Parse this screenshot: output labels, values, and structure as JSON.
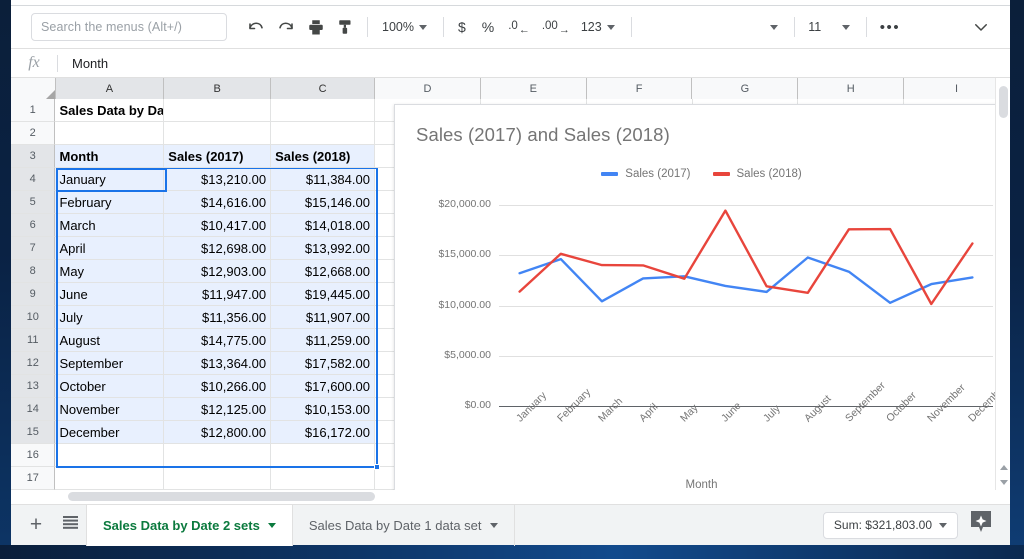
{
  "toolbar": {
    "search_placeholder": "Search the menus (Alt+/)",
    "undo": "undo-icon",
    "redo": "redo-icon",
    "print": "print-icon",
    "paint_format": "paint-format-icon",
    "zoom": "100%",
    "currency": "$",
    "percent": "%",
    "decrease_decimal": ".0",
    "increase_decimal": ".00",
    "number_format": "123",
    "font_family": "",
    "font_size": "11",
    "more": "•••"
  },
  "formula_bar": {
    "fx_label": "fx",
    "value": "Month"
  },
  "grid": {
    "columns": [
      "A",
      "B",
      "C",
      "D",
      "E",
      "F",
      "G",
      "H",
      "I"
    ],
    "selected_columns": [
      "A",
      "B",
      "C"
    ],
    "row_numbers": [
      "1",
      "2",
      "3",
      "4",
      "5",
      "6",
      "7",
      "8",
      "9",
      "10",
      "11",
      "12",
      "13",
      "14",
      "15",
      "16",
      "17"
    ],
    "title_cell": "Sales Data by Date",
    "headers": [
      "Month",
      "Sales (2017)",
      "Sales (2018)"
    ],
    "rows": [
      [
        "January",
        "$13,210.00",
        "$11,384.00"
      ],
      [
        "February",
        "$14,616.00",
        "$15,146.00"
      ],
      [
        "March",
        "$10,417.00",
        "$14,018.00"
      ],
      [
        "April",
        "$12,698.00",
        "$13,992.00"
      ],
      [
        "May",
        "$12,903.00",
        "$12,668.00"
      ],
      [
        "June",
        "$11,947.00",
        "$19,445.00"
      ],
      [
        "July",
        "$11,356.00",
        "$11,907.00"
      ],
      [
        "August",
        "$14,775.00",
        "$11,259.00"
      ],
      [
        "September",
        "$13,364.00",
        "$17,582.00"
      ],
      [
        "October",
        "$10,266.00",
        "$17,600.00"
      ],
      [
        "November",
        "$12,125.00",
        "$10,153.00"
      ],
      [
        "December",
        "$12,800.00",
        "$16,172.00"
      ]
    ]
  },
  "chart_data": {
    "type": "line",
    "title": "Sales (2017) and Sales (2018)",
    "xlabel": "Month",
    "ylabel": "",
    "categories": [
      "January",
      "February",
      "March",
      "April",
      "May",
      "June",
      "July",
      "August",
      "September",
      "October",
      "November",
      "December"
    ],
    "series": [
      {
        "name": "Sales (2017)",
        "color": "#4285f4",
        "values": [
          13210,
          14616,
          10417,
          12698,
          12903,
          11947,
          11356,
          14775,
          13364,
          10266,
          12125,
          12800
        ]
      },
      {
        "name": "Sales (2018)",
        "color": "#e8453c",
        "values": [
          11384,
          15146,
          14018,
          13992,
          12668,
          19445,
          11907,
          11259,
          17582,
          17600,
          10153,
          16172
        ]
      }
    ],
    "ylim": [
      0,
      20000
    ],
    "yticks": [
      0,
      5000,
      10000,
      15000,
      20000
    ],
    "ytick_labels": [
      "$0.00",
      "$5,000.00",
      "$10,000.00",
      "$15,000.00",
      "$20,000.00"
    ],
    "grid": true,
    "legend_position": "top"
  },
  "tabs": {
    "add_label": "+",
    "all_sheets_label": "all-sheets-icon",
    "items": [
      {
        "label": "Sales Data by Date 2 sets",
        "active": true
      },
      {
        "label": "Sales Data by Date 1 data set",
        "active": false
      }
    ]
  },
  "status": {
    "sum": "Sum: $321,803.00",
    "explore": "explore-icon"
  },
  "colors": {
    "series_2017": "#4285f4",
    "series_2018": "#e8453c",
    "active_tab": "#0b7a3e",
    "selection": "#1a73e8",
    "selection_fill": "#e8f0fe"
  }
}
